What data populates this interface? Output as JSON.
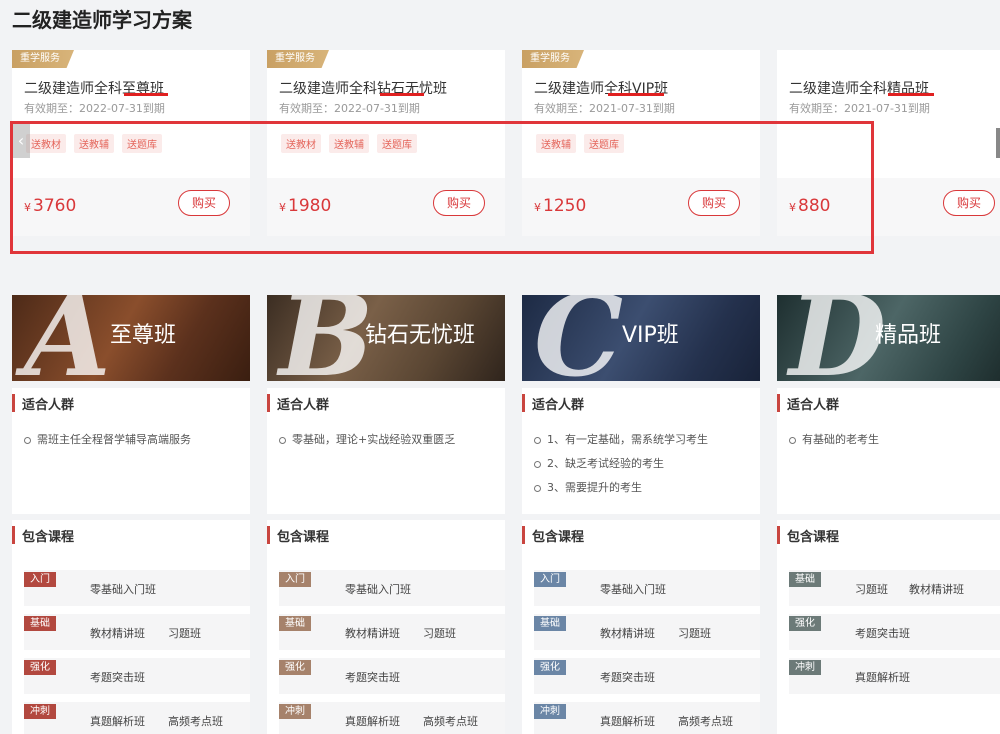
{
  "page": {
    "title": "二级建造师学习方案"
  },
  "cards": [
    {
      "service": "重学服务",
      "title": "二级建造师全科至尊班",
      "date": "有效期至：2022-07-31到期",
      "gifts": [
        "送教材",
        "送教辅",
        "送题库"
      ],
      "currency": "¥",
      "price": "3760",
      "buy": "购买"
    },
    {
      "service": "重学服务",
      "title": "二级建造师全科钻石无忧班",
      "date": "有效期至：2022-07-31到期",
      "gifts": [
        "送教材",
        "送教辅",
        "送题库"
      ],
      "currency": "¥",
      "price": "1980",
      "buy": "购买"
    },
    {
      "service": "重学服务",
      "title": "二级建造师全科VIP班",
      "date": "有效期至：2021-07-31到期",
      "gifts": [
        "送教辅",
        "送题库"
      ],
      "currency": "¥",
      "price": "1250",
      "buy": "购买"
    },
    {
      "service": "",
      "title": "二级建造师全科精品班",
      "date": "有效期至：2021-07-31到期",
      "gifts": [],
      "currency": "¥",
      "price": "880",
      "buy": "购买"
    }
  ],
  "banners": [
    {
      "letter": "A",
      "name": "至尊班"
    },
    {
      "letter": "B",
      "name": "钻石无忧班"
    },
    {
      "letter": "C",
      "name": "VIP班"
    },
    {
      "letter": "D",
      "name": "精品班"
    }
  ],
  "audience": {
    "label": "适合人群",
    "columns": [
      [
        "需班主任全程督学辅导高端服务"
      ],
      [
        "零基础，理论+实战经验双重匮乏"
      ],
      [
        "1、有一定基础，需系统学习考生",
        "2、缺乏考试经验的考生",
        "3、需要提升的考生"
      ],
      [
        "有基础的老考生"
      ]
    ]
  },
  "courses": {
    "label": "包含课程",
    "columns": [
      [
        {
          "stage": "入门",
          "items": [
            "零基础入门班"
          ]
        },
        {
          "stage": "基础",
          "items": [
            "教材精讲班",
            "习题班"
          ]
        },
        {
          "stage": "强化",
          "items": [
            "考题突击班"
          ]
        },
        {
          "stage": "冲刺",
          "items": [
            "真题解析班",
            "高频考点班"
          ]
        }
      ],
      [
        {
          "stage": "入门",
          "items": [
            "零基础入门班"
          ]
        },
        {
          "stage": "基础",
          "items": [
            "教材精讲班",
            "习题班"
          ]
        },
        {
          "stage": "强化",
          "items": [
            "考题突击班"
          ]
        },
        {
          "stage": "冲刺",
          "items": [
            "真题解析班",
            "高频考点班"
          ]
        }
      ],
      [
        {
          "stage": "入门",
          "items": [
            "零基础入门班"
          ]
        },
        {
          "stage": "基础",
          "items": [
            "教材精讲班",
            "习题班"
          ]
        },
        {
          "stage": "强化",
          "items": [
            "考题突击班"
          ]
        },
        {
          "stage": "冲刺",
          "items": [
            "真题解析班",
            "高频考点班"
          ]
        }
      ],
      [
        {
          "stage": "基础",
          "items": [
            "习题班",
            "教材精讲班"
          ]
        },
        {
          "stage": "强化",
          "items": [
            "考题突击班"
          ]
        },
        {
          "stage": "冲刺",
          "items": [
            "真题解析班"
          ]
        }
      ]
    ]
  },
  "colors": {
    "accent_red": "#d9383a",
    "annotation_red": "#e02020",
    "tag_gold": "#c9a063"
  },
  "icons": {
    "prev_arrow": "chevron-left-icon"
  }
}
